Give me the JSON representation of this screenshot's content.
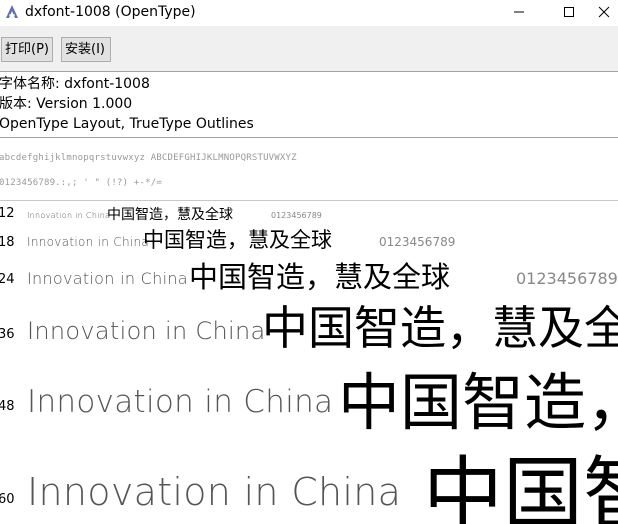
{
  "window": {
    "title": "dxfont-1008 (OpenType)",
    "controls": {
      "minimize": "—",
      "maximize": "☐",
      "close": "✕"
    }
  },
  "toolbar": {
    "print_label": "打印(P)",
    "install_label": "安装(I)"
  },
  "info": {
    "font_name": "字体名称: dxfont-1008",
    "version": "版本: Version 1.000",
    "outlines": "OpenType Layout, TrueType Outlines"
  },
  "charset": {
    "letters": "abcdefghijklmnopqrstuvwxyz ABCDEFGHIJKLMNOPQRSTUVWXYZ",
    "digits_symbols": "0123456789.:,; ' \" (!?) +-*/="
  },
  "samples": {
    "latin": "Innovation in China",
    "cjk": "中国智造，慧及全球",
    "digits": "0123456789",
    "rows": [
      {
        "size": "12"
      },
      {
        "size": "18"
      },
      {
        "size": "24"
      },
      {
        "size": "36"
      },
      {
        "size": "48"
      },
      {
        "size": "60"
      }
    ]
  }
}
